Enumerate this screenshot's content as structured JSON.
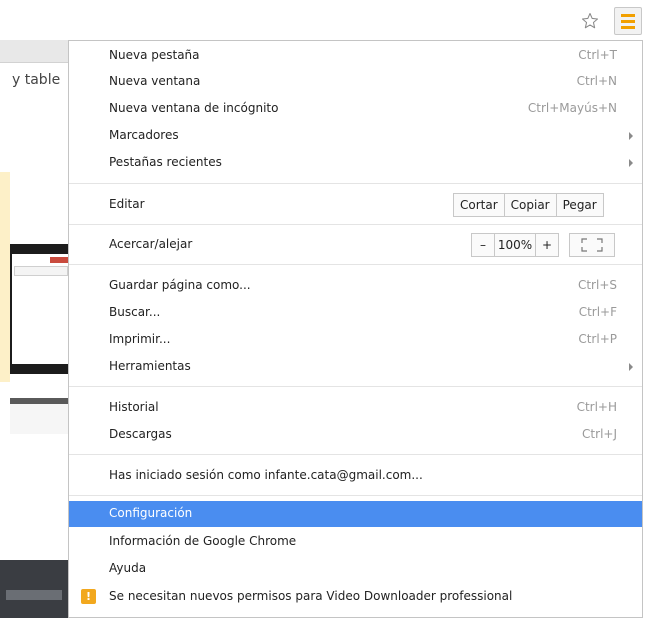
{
  "page": {
    "partial_text": "y table"
  },
  "toolbar": {
    "icons": [
      "star-icon",
      "hamburger-menu-icon"
    ],
    "accent_color": "#f2a000"
  },
  "menu": {
    "highlight_color": "#4a8df0",
    "items": {
      "new_tab": {
        "label": "Nueva pestaña",
        "shortcut": "Ctrl+T"
      },
      "new_window": {
        "label": "Nueva ventana",
        "shortcut": "Ctrl+N"
      },
      "incognito": {
        "label": "Nueva ventana de incógnito",
        "shortcut": "Ctrl+Mayús+N"
      },
      "bookmarks": {
        "label": "Marcadores"
      },
      "recent_tabs": {
        "label": "Pestañas recientes"
      },
      "edit": {
        "label": "Editar",
        "cut": "Cortar",
        "copy": "Copiar",
        "paste": "Pegar"
      },
      "zoom": {
        "label": "Acercar/alejar",
        "minus": "–",
        "level": "100%",
        "plus": "+"
      },
      "save_page": {
        "label": "Guardar página como...",
        "shortcut": "Ctrl+S"
      },
      "find": {
        "label": "Buscar...",
        "shortcut": "Ctrl+F"
      },
      "print": {
        "label": "Imprimir...",
        "shortcut": "Ctrl+P"
      },
      "tools": {
        "label": "Herramientas"
      },
      "history": {
        "label": "Historial",
        "shortcut": "Ctrl+H"
      },
      "downloads": {
        "label": "Descargas",
        "shortcut": "Ctrl+J"
      },
      "signed_in": {
        "label": "Has iniciado sesión como infante.cata@gmail.com..."
      },
      "settings": {
        "label": "Configuración"
      },
      "about": {
        "label": "Información de Google Chrome"
      },
      "help": {
        "label": "Ayuda"
      },
      "permissions": {
        "icon_text": "!",
        "label": "Se necesitan nuevos permisos para Video Downloader professional"
      }
    }
  }
}
